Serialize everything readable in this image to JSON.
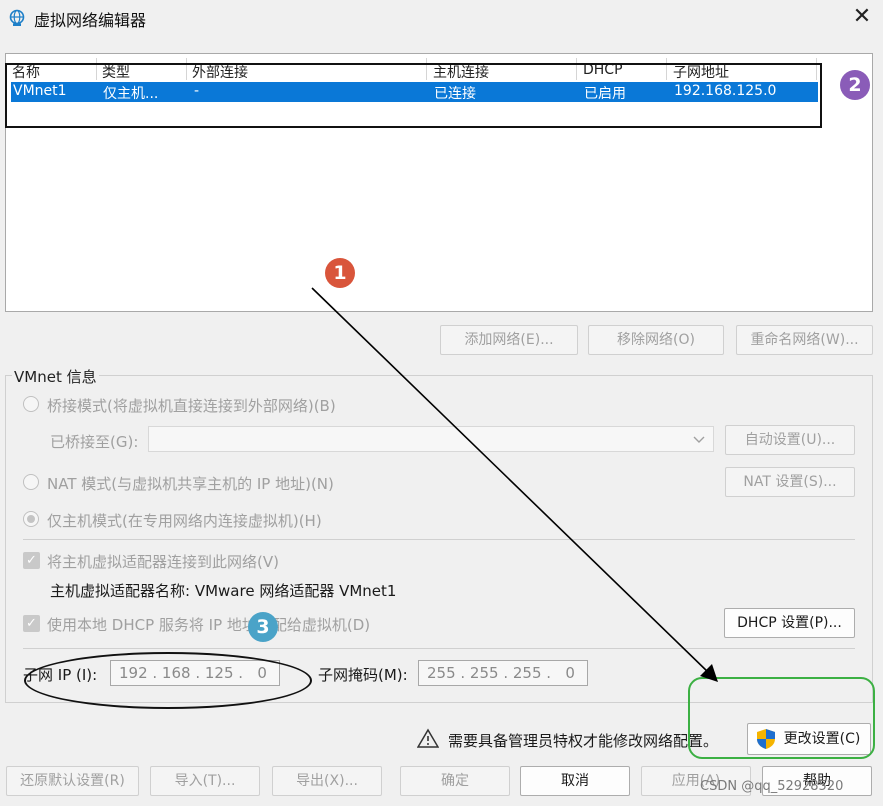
{
  "window": {
    "title": "虚拟网络编辑器",
    "close_symbol": "✕"
  },
  "network_table": {
    "columns": [
      "名称",
      "类型",
      "外部连接",
      "主机连接",
      "DHCP",
      "子网地址"
    ],
    "rows": [
      {
        "name": "VMnet1",
        "type": "仅主机...",
        "external": "-",
        "host": "已连接",
        "dhcp": "已启用",
        "subnet": "192.168.125.0"
      }
    ]
  },
  "list_buttons": {
    "add": "添加网络(E)...",
    "remove": "移除网络(O)",
    "rename": "重命名网络(W)..."
  },
  "vmnet_info": {
    "group_label": "VMnet 信息",
    "bridged_mode": "桥接模式(将虚拟机直接连接到外部网络)(B)",
    "bridged_to_label": "已桥接至(G):",
    "bridged_to_value": "",
    "auto_settings": "自动设置(U)...",
    "nat_mode": "NAT 模式(与虚拟机共享主机的 IP 地址)(N)",
    "nat_settings": "NAT 设置(S)...",
    "host_only_mode": "仅主机模式(在专用网络内连接虚拟机)(H)",
    "connect_adapter": "将主机虚拟适配器连接到此网络(V)",
    "adapter_name": "主机虚拟适配器名称: VMware 网络适配器 VMnet1",
    "use_dhcp": "使用本地 DHCP 服务将 IP 地址分配给虚拟机(D)",
    "dhcp_settings": "DHCP 设置(P)...",
    "subnet_ip_label": "子网 IP (I):",
    "subnet_ip_value": "192 . 168 . 125 .   0",
    "subnet_mask_label": "子网掩码(M):",
    "subnet_mask_value": "255 . 255 . 255 .   0"
  },
  "admin_notice": {
    "text": "需要具备管理员特权才能修改网络配置。",
    "change_settings": "更改设置(C)"
  },
  "bottom_buttons": {
    "restore": "还原默认设置(R)",
    "import": "导入(T)...",
    "export": "导出(X)...",
    "ok": "确定",
    "cancel": "取消",
    "apply": "应用(A)",
    "help": "帮助"
  },
  "annotations": {
    "badge1": "1",
    "badge2": "2",
    "badge3": "3"
  },
  "watermark": "CSDN @qq_52928520",
  "colors": {
    "selection": "#0a78d7",
    "badge1": "#d9553b",
    "badge2": "#8a5cb8",
    "badge3": "#4aa3c8",
    "highlight_green": "#3cb043"
  }
}
